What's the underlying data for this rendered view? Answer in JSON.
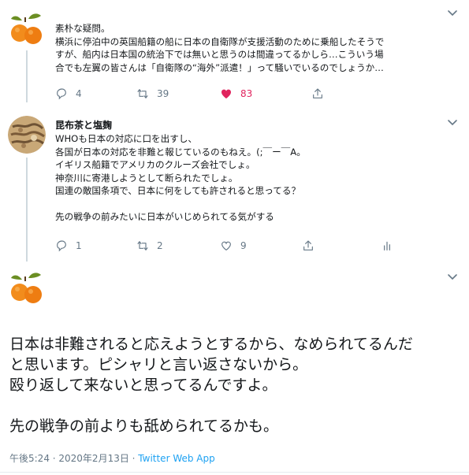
{
  "colors": {
    "text": "#14171a",
    "secondary": "#657786",
    "link": "#1da1f2",
    "like": "#e0245e",
    "thread_line": "#cfd9de"
  },
  "tweet1": {
    "avatar_icon": "orange-avatar-icon",
    "lines": [
      "素朴な疑問。",
      "横浜に停泊中の英国船籍の船に日本の自衛隊が支援活動のために乗船したそうで",
      "すが、船内は日本国の統治下では無いと思うのは間違ってるかしら…こういう場",
      "合でも左翼の皆さんは「自衛隊の“海外”派遣！」って騒いでいるのでしょうか…"
    ],
    "reply_count": "4",
    "retweet_count": "39",
    "like_count": "83"
  },
  "tweet2": {
    "avatar_icon": "kombucha-avatar-icon",
    "name": "昆布茶と塩麹",
    "lines": [
      "WHOも日本の対応に口を出すし、",
      "各国が日本の対応を非難と報じているのもねえ。(;￣ー￣A。",
      "イギリス船籍でアメリカのクルーズ会社でしょ。",
      "神奈川に寄港しようとして断られたでしょ。",
      "国連の敵国条項で、日本に何をしても許されると思ってる？",
      "",
      "先の戦争の前みたいに日本がいじめられてる気がする"
    ],
    "reply_count": "1",
    "retweet_count": "2",
    "like_count": "9"
  },
  "main_tweet": {
    "avatar_icon": "orange-avatar-icon",
    "lines": [
      "日本は非難されると応えようとするから、なめられてるんだ",
      "と思います。ピシャリと言い返さないから。",
      "殴り返して来ないと思ってるんですよ。",
      "",
      "先の戦争の前よりも舐められてるかも。"
    ],
    "timestamp": "午後5:24 · 2020年2月13日 · ",
    "source": "Twitter Web App"
  }
}
